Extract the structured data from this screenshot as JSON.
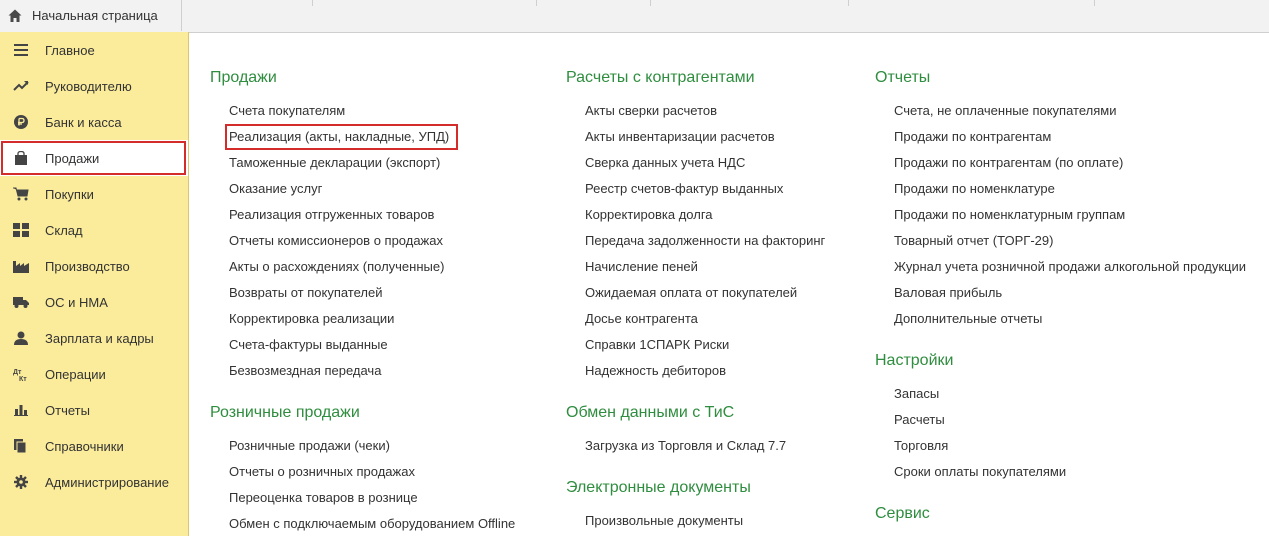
{
  "tabs": {
    "home_label": "Начальная страница"
  },
  "sidebar": {
    "items": [
      {
        "label": "Главное",
        "icon": "menu-icon"
      },
      {
        "label": "Руководителю",
        "icon": "trend-icon"
      },
      {
        "label": "Банк и касса",
        "icon": "ruble-coin-icon"
      },
      {
        "label": "Продажи",
        "icon": "shopping-bag-icon"
      },
      {
        "label": "Покупки",
        "icon": "cart-icon"
      },
      {
        "label": "Склад",
        "icon": "warehouse-grid-icon"
      },
      {
        "label": "Производство",
        "icon": "factory-icon"
      },
      {
        "label": "ОС и НМА",
        "icon": "truck-icon"
      },
      {
        "label": "Зарплата и кадры",
        "icon": "person-icon"
      },
      {
        "label": "Операции",
        "icon": "dt-kt-icon"
      },
      {
        "label": "Отчеты",
        "icon": "bar-chart-icon"
      },
      {
        "label": "Справочники",
        "icon": "books-icon"
      },
      {
        "label": "Администрирование",
        "icon": "gear-icon"
      }
    ],
    "active": "Продажи"
  },
  "sections": {
    "sales": {
      "title": "Продажи",
      "links": [
        "Счета покупателям",
        "Реализация (акты, накладные, УПД)",
        "Таможенные декларации (экспорт)",
        "Оказание услуг",
        "Реализация отгруженных товаров",
        "Отчеты комиссионеров о продажах",
        "Акты о расхождениях (полученные)",
        "Возвраты от покупателей",
        "Корректировка реализации",
        "Счета-фактуры выданные",
        "Безвозмездная передача"
      ]
    },
    "retail": {
      "title": "Розничные продажи",
      "links": [
        "Розничные продажи (чеки)",
        "Отчеты о розничных продажах",
        "Переоценка товаров в рознице",
        "Обмен с подключаемым оборудованием Offline"
      ]
    },
    "settlements": {
      "title": "Расчеты с контрагентами",
      "links": [
        "Акты сверки расчетов",
        "Акты инвентаризации расчетов",
        "Сверка данных учета НДС",
        "Реестр счетов-фактур выданных",
        "Корректировка долга",
        "Передача задолженности на факторинг",
        "Начисление пеней",
        "Ожидаемая оплата от покупателей",
        "Досье контрагента",
        "Справки 1СПАРК Риски",
        "Надежность дебиторов"
      ]
    },
    "exchange": {
      "title": "Обмен данными с ТиС",
      "links": [
        "Загрузка из Торговля и Склад 7.7"
      ]
    },
    "edocs": {
      "title": "Электронные документы",
      "links": [
        "Произвольные документы"
      ]
    },
    "reports": {
      "title": "Отчеты",
      "links": [
        "Счета, не оплаченные покупателями",
        "Продажи по контрагентам",
        "Продажи по контрагентам (по оплате)",
        "Продажи по номенклатуре",
        "Продажи по номенклатурным группам",
        "Товарный отчет (ТОРГ-29)",
        "Журнал учета розничной продажи алкогольной продукции",
        "Валовая прибыль",
        "Дополнительные отчеты"
      ]
    },
    "settings": {
      "title": "Настройки",
      "links": [
        "Запасы",
        "Расчеты",
        "Торговля",
        "Сроки оплаты покупателями"
      ]
    },
    "service": {
      "title": "Сервис"
    }
  },
  "colors": {
    "sidebar_bg": "#fbec9c",
    "section_title": "#2f8d3f",
    "highlight": "#d42b2b"
  }
}
